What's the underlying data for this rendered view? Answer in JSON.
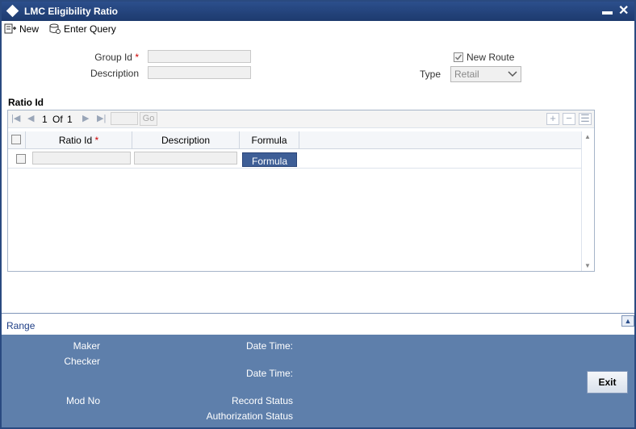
{
  "window": {
    "title": "LMC Eligibility Ratio"
  },
  "toolbar": {
    "new_label": "New",
    "enter_query_label": "Enter Query"
  },
  "form": {
    "group_id_label": "Group Id",
    "description_label": "Description",
    "new_route_label": "New Route",
    "new_route_checked": true,
    "type_label": "Type",
    "type_value": "Retail",
    "required_mark": "*"
  },
  "ratio_section": {
    "title": "Ratio Id",
    "pager": {
      "current": "1",
      "of_label": "Of",
      "total": "1",
      "go_label": "Go"
    },
    "columns": [
      "Ratio Id",
      "Description",
      "Formula"
    ],
    "row_button_label": "Formula"
  },
  "range": {
    "label": "Range"
  },
  "footer": {
    "maker_label": "Maker",
    "checker_label": "Checker",
    "date_time_label": "Date Time:",
    "date_time_label_2": "Date Time:",
    "mod_no_label": "Mod No",
    "record_status_label": "Record Status",
    "authorization_status_label": "Authorization Status",
    "exit_label": "Exit"
  },
  "colors": {
    "titlebar": "#2c4f8c",
    "footer": "#5e7fab",
    "required": "#cc0000",
    "link": "#1f3f86"
  }
}
